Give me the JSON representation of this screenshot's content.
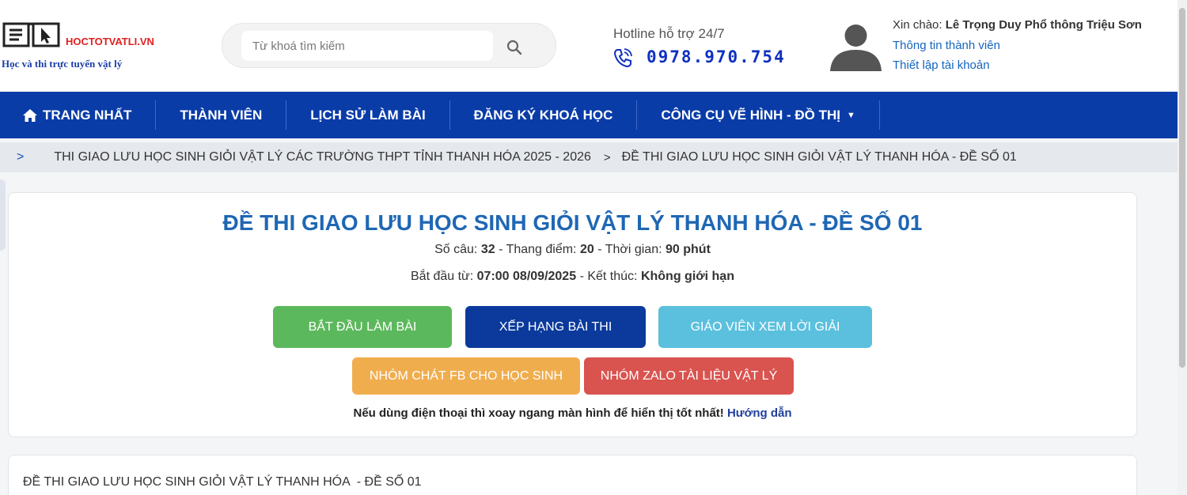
{
  "header": {
    "logo": {
      "name": "HOCTOTVATLI.VN",
      "slogan": "Học và thi trực tuyến vật lý"
    },
    "search": {
      "placeholder": "Từ khoá tìm kiếm",
      "value": ""
    },
    "hotline": {
      "label": "Hotline hỗ trợ 24/7",
      "number": "0978.970.754"
    },
    "user": {
      "greeting_prefix": "Xin chào:",
      "name": "Lê Trọng Duy Phổ thông Triệu Sơn",
      "profile_link": "Thông tin thành viên",
      "settings_link": "Thiết lập tài khoản"
    }
  },
  "nav": {
    "items": [
      {
        "label": "TRANG NHẤT",
        "icon": "home-icon"
      },
      {
        "label": "THÀNH VIÊN"
      },
      {
        "label": "LỊCH SỬ LÀM BÀI"
      },
      {
        "label": "ĐĂNG KÝ KHOÁ HỌC"
      },
      {
        "label": "CÔNG CỤ VẼ HÌNH - ĐỒ THỊ",
        "dropdown": true
      }
    ]
  },
  "breadcrumb": {
    "items": [
      "THI GIAO LƯU HỌC SINH GIỎI VẬT LÝ CÁC TRƯỜNG THPT TỈNH THANH HÓA 2025 - 2026",
      "ĐỀ THI GIAO LƯU HỌC SINH GIỎI VẬT LÝ THANH HÓA - ĐỀ SỐ 01"
    ]
  },
  "exam": {
    "title": "ĐỀ THI GIAO LƯU HỌC SINH GIỎI VẬT LÝ THANH HÓA - ĐỀ SỐ 01",
    "questions_label": "Số câu:",
    "questions": "32",
    "score_label": "Thang điểm:",
    "score": "20",
    "time_label": "Thời gian:",
    "time": "90 phút",
    "start_label": "Bắt đầu từ:",
    "start": "07:00 08/09/2025",
    "end_label": "Kết thúc:",
    "end": "Không giới hạn",
    "sep": "-",
    "buttons": {
      "start": "BẮT ĐẦU LÀM BÀI",
      "rank": "XẾP HẠNG BÀI THI",
      "teacher": "GIÁO VIÊN XEM LỜI GIẢI",
      "fb": "NHÓM CHÁT FB CHO HỌC SINH",
      "zalo": "NHÓM ZALO TÀI LIỆU VẬT LÝ"
    },
    "note": "Nếu dùng điện thoại thì xoay ngang màn hình để hiển thị tốt nhất!",
    "note_link": "Hướng dẫn"
  },
  "section": {
    "title": "ĐỀ THI GIAO LƯU HỌC SINH GIỎI VẬT LÝ THANH HÓA  - ĐỀ SỐ 01"
  },
  "colors": {
    "nav_bg": "#0a3ca8",
    "title": "#1f67b4",
    "start_btn": "#5cb85c",
    "rank_btn": "#0b3a9c",
    "teacher_btn": "#5bc0de",
    "fb_btn": "#f0ad4e",
    "zalo_btn": "#d9534f"
  }
}
